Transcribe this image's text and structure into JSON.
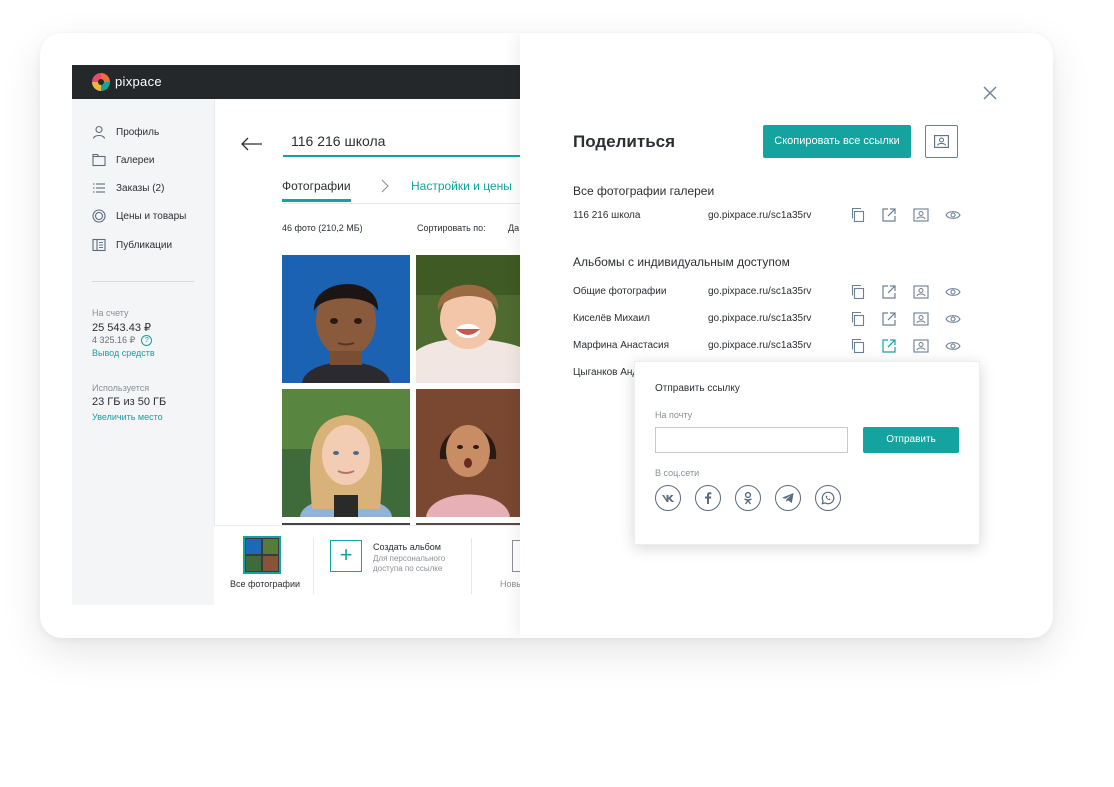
{
  "app": {
    "logo": "pixpace",
    "sidebar": {
      "items": [
        {
          "label": "Профиль",
          "icon": "user-icon"
        },
        {
          "label": "Галереи",
          "icon": "folder-icon"
        },
        {
          "label": "Заказы (2)",
          "icon": "list-icon"
        },
        {
          "label": "Цены и товары",
          "icon": "price-icon"
        },
        {
          "label": "Публикации",
          "icon": "publication-icon"
        }
      ],
      "balance_label": "На счету",
      "balance_value": "25 543.43 ₽",
      "balance_sub": "4 325.16 ₽",
      "withdraw_link": "Вывод средств",
      "storage_label": "Используется",
      "storage_value": "23 ГБ из 50 ГБ",
      "storage_link": "Увеличить место"
    },
    "gallery": {
      "title": "116 216 школа",
      "tabs": [
        "Фотографии",
        "Настройки и цены"
      ],
      "photo_count": "46 фото (210,2 МБ)",
      "sort_label": "Сортировать по:",
      "sort_value": "Да"
    },
    "albums_bar": {
      "all_photos": "Все фотографии",
      "create_title": "Создать альбом",
      "create_sub": "Для персонального доступа по ссылке",
      "next_label": "Новы"
    }
  },
  "share": {
    "title": "Поделиться",
    "copy_all_label": "Скопировать все ссылки",
    "all_photos_title": "Все фотографии галереи",
    "gallery_row": {
      "name": "116 216 школа",
      "link": "go.pixpace.ru/sc1a35rv"
    },
    "albums_title": "Альбомы с индивидуальным доступом",
    "album_rows": [
      {
        "name": "Общие фотографии",
        "link": "go.pixpace.ru/sc1a35rv"
      },
      {
        "name": "Киселёв Михаил",
        "link": "go.pixpace.ru/sc1a35rv"
      },
      {
        "name": "Марфина Анастасия",
        "link": "go.pixpace.ru/sc1a35rv"
      },
      {
        "name": "Цыганков Андрей",
        "link": ""
      }
    ],
    "popup": {
      "title": "Отправить ссылку",
      "email_label": "На почту",
      "email_value": "",
      "send_label": "Отправить",
      "social_label": "В соц.сети",
      "socials": [
        "vk-icon",
        "facebook-icon",
        "odnoklassniki-icon",
        "telegram-icon",
        "whatsapp-icon"
      ]
    }
  },
  "colors": {
    "accent": "#15a3a0",
    "topbar": "#25282b",
    "icon": "#5a6b7e"
  }
}
